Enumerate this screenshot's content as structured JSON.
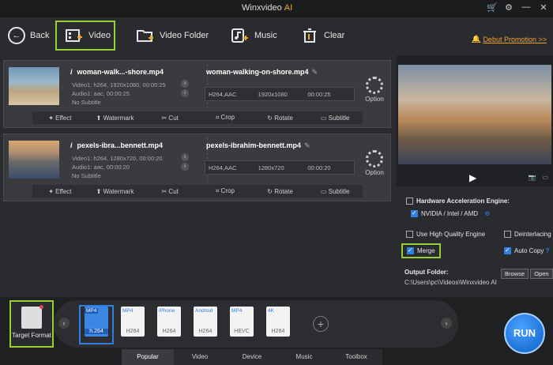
{
  "app": {
    "title": "Winxvideo",
    "title_ai": "AI",
    "icons": [
      "cart-icon",
      "settings-icon",
      "minimize-icon",
      "close-icon"
    ]
  },
  "toolbar": {
    "back": "Back",
    "video": "Video",
    "video_folder": "Video Folder",
    "music": "Music",
    "clear": "Clear",
    "promo": "Debut Promotion >>"
  },
  "items": [
    {
      "src": "woman-walk...-shore.mp4",
      "video": "Video1: h264, 1920x1080, 00:00:25",
      "audio": "Audio1: aac, 00:00:25",
      "subtitle": "No Subtitle",
      "out": "woman-walking-on-shore.mp4",
      "codec": "H264,AAC",
      "res": "1920x1080",
      "dur": "00:00:25"
    },
    {
      "src": "pexels-ibra...bennett.mp4",
      "video": "Video1: h264, 1280x720, 00:00:20",
      "audio": "Audio1: aac, 00:00:20",
      "subtitle": "No Subtitle",
      "out": "pexels-ibrahim-bennett.mp4",
      "codec": "H264,AAC",
      "res": "1280x720",
      "dur": "00:00:20"
    }
  ],
  "option_label": "Option",
  "effects": {
    "effect": "Effect",
    "watermark": "Watermark",
    "cut": "Cut",
    "crop": "Crop",
    "rotate": "Rotate",
    "subtitle": "Subtitle"
  },
  "settings": {
    "hae_title": "Hardware Acceleration Engine:",
    "hae_value": "NVIDIA / Intel / AMD",
    "high_quality": "Use High Quality Engine",
    "deinterlacing": "Deinterlacing",
    "merge": "Merge",
    "auto_copy": "Auto Copy",
    "output_folder": "Output Folder:",
    "path": "C:\\Users\\pc\\Videos\\Winxvideo AI",
    "browse": "Browse",
    "open": "Open"
  },
  "bottom": {
    "target_format": "Target Format",
    "formats": [
      {
        "top": "MP4",
        "bottom": "h.264"
      },
      {
        "top": "MP4",
        "bottom": "H264"
      },
      {
        "top": "iPhone",
        "bottom": "H264"
      },
      {
        "top": "Android",
        "bottom": "H264"
      },
      {
        "top": "MP4",
        "bottom": "HEVC"
      },
      {
        "top": "4K",
        "bottom": "H264"
      }
    ],
    "tabs": [
      "Popular",
      "Video",
      "Device",
      "Music",
      "Toolbox"
    ],
    "run": "RUN"
  },
  "colors": {
    "accent_green": "#9acd32",
    "accent_blue": "#2f7fe0",
    "orange": "#f0a62e"
  }
}
